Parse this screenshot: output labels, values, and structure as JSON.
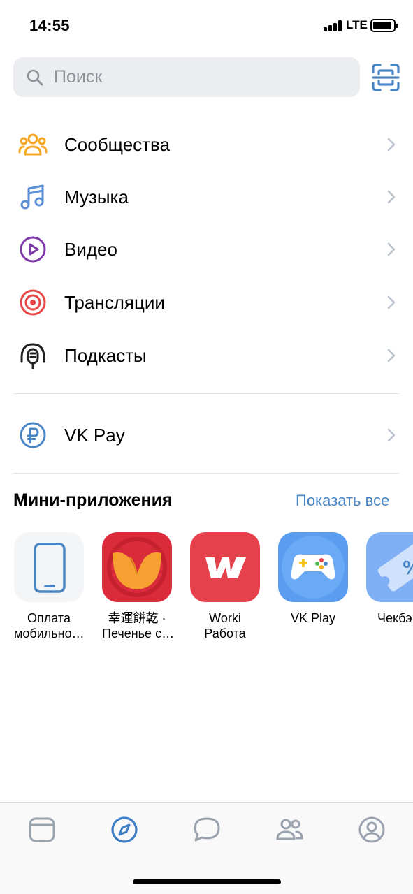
{
  "status_bar": {
    "time": "14:55",
    "network": "LTE"
  },
  "search": {
    "placeholder": "Поиск"
  },
  "menu": {
    "items": [
      {
        "label": "Сообщества",
        "icon": "communities-icon",
        "color": "#f5a623"
      },
      {
        "label": "Музыка",
        "icon": "music-note-icon",
        "color": "#5a8fd6"
      },
      {
        "label": "Видео",
        "icon": "video-play-icon",
        "color": "#7e3aa8"
      },
      {
        "label": "Трансляции",
        "icon": "broadcast-target-icon",
        "color": "#e64646"
      },
      {
        "label": "Подкасты",
        "icon": "podcast-microphone-icon",
        "color": "#222222"
      }
    ],
    "pay": {
      "label": "VK Pay",
      "icon": "ruble-circle-icon",
      "color": "#4a86c5"
    }
  },
  "mini_apps": {
    "title": "Мини-приложения",
    "show_all": "Показать все",
    "apps": [
      {
        "line1": "Оплата",
        "line2": "мобильно…",
        "icon": "phone-icon"
      },
      {
        "line1": "幸運餅乾 ·",
        "line2": "Печенье с…",
        "icon": "fortune-cookie-icon"
      },
      {
        "line1": "Worki",
        "line2": "Работа",
        "icon": "worki-logo-icon"
      },
      {
        "line1": "VK Play",
        "line2": "",
        "icon": "gamepad-icon"
      },
      {
        "line1": "Чекбэ",
        "line2": "",
        "icon": "discount-ticket-icon"
      }
    ]
  },
  "tab_bar": {
    "tabs": [
      "news-tab-icon",
      "explore-compass-icon",
      "messages-icon",
      "friends-icon",
      "profile-icon"
    ],
    "active": "explore-compass-icon",
    "active_color": "#3f7dc4",
    "inactive_color": "#99a2ad"
  },
  "colors": {
    "accent": "#4a86c5",
    "search_bg": "#ebedf0"
  }
}
